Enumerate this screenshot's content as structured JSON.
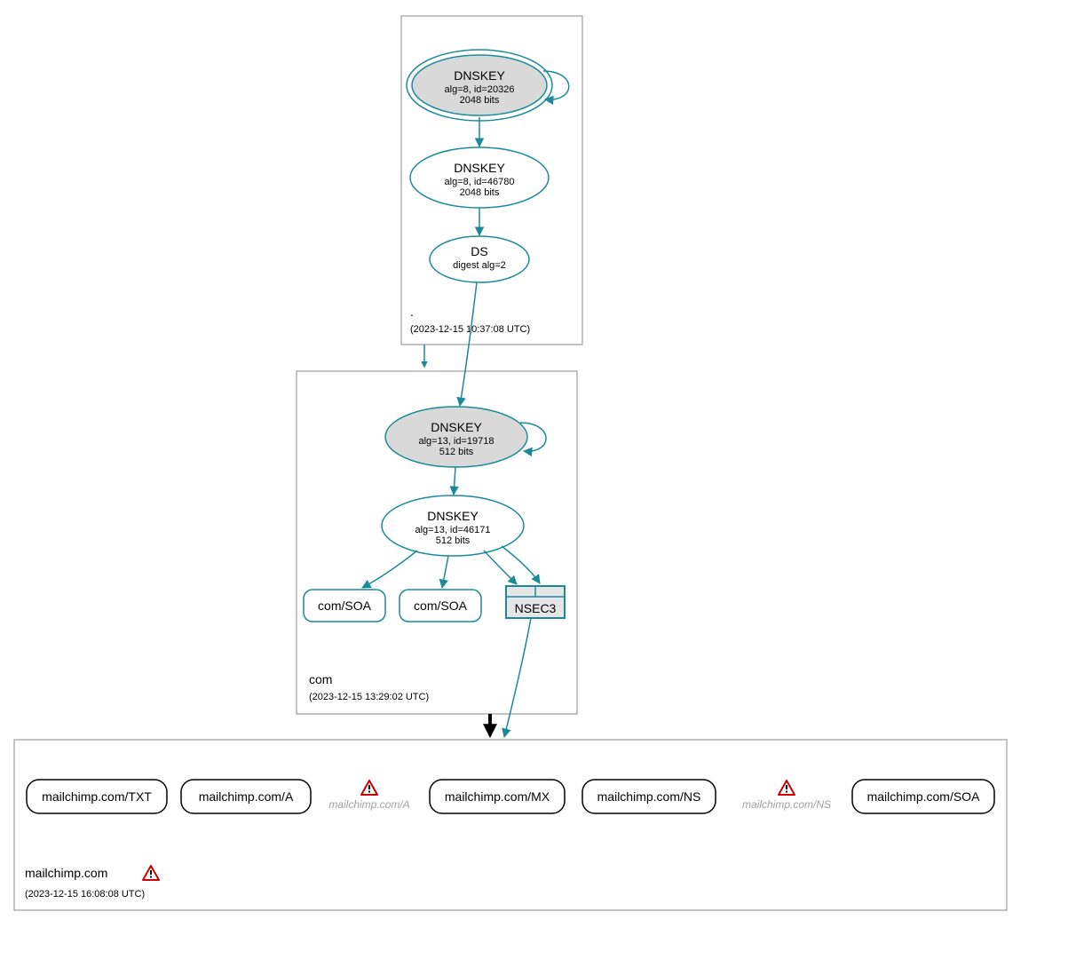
{
  "colors": {
    "teal": "#1a8a9a",
    "grey_fill": "#d9d9d9",
    "warn_red": "#cc0000",
    "box_stroke": "#888888"
  },
  "zones": {
    "root": {
      "name": ".",
      "timestamp": "(2023-12-15 10:37:08 UTC)"
    },
    "com": {
      "name": "com",
      "timestamp": "(2023-12-15 13:29:02 UTC)"
    },
    "mailchimp": {
      "name": "mailchimp.com",
      "timestamp": "(2023-12-15 16:08:08 UTC)"
    }
  },
  "nodes": {
    "root_ksk": {
      "title": "DNSKEY",
      "line2": "alg=8, id=20326",
      "line3": "2048 bits"
    },
    "root_zsk": {
      "title": "DNSKEY",
      "line2": "alg=8, id=46780",
      "line3": "2048 bits"
    },
    "root_ds": {
      "title": "DS",
      "line2": "digest alg=2"
    },
    "com_ksk": {
      "title": "DNSKEY",
      "line2": "alg=13, id=19718",
      "line3": "512 bits"
    },
    "com_zsk": {
      "title": "DNSKEY",
      "line2": "alg=13, id=46171",
      "line3": "512 bits"
    },
    "com_soa1": "com/SOA",
    "com_soa2": "com/SOA",
    "nsec3": "NSEC3",
    "mc_txt": "mailchimp.com/TXT",
    "mc_a": "mailchimp.com/A",
    "mc_a_warn": "mailchimp.com/A",
    "mc_mx": "mailchimp.com/MX",
    "mc_ns": "mailchimp.com/NS",
    "mc_ns_warn": "mailchimp.com/NS",
    "mc_soa": "mailchimp.com/SOA"
  }
}
